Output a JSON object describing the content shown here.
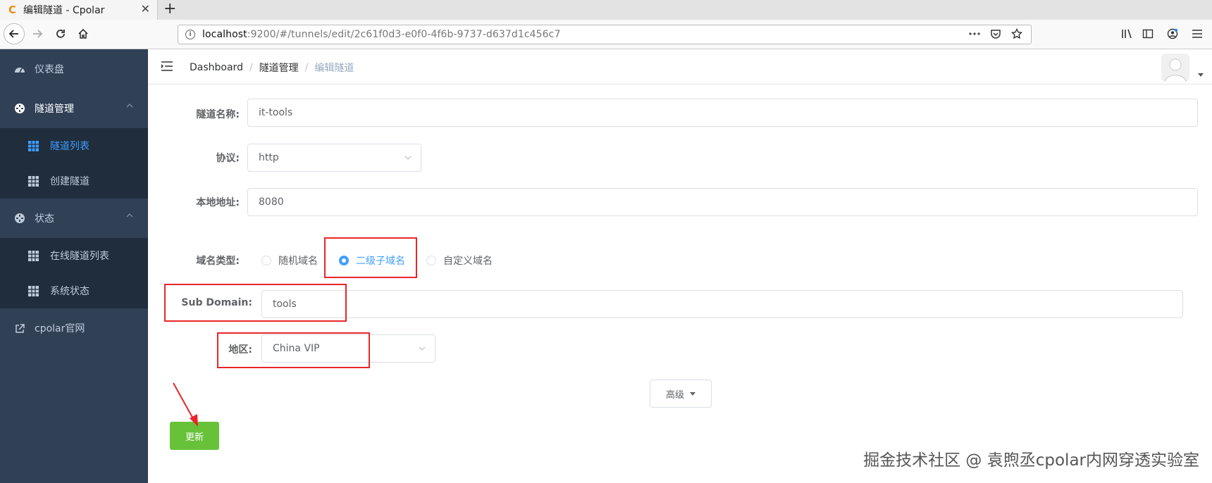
{
  "browser": {
    "tab_title": "编辑隧道 - Cpolar",
    "tab_favicon": "C",
    "url_host": "localhost",
    "url_rest": ":9200/#/tunnels/edit/2c61f0d3-e0f0-4f6b-9737-d637d1c456c7",
    "new_tab_label": "+",
    "close_label": "✕"
  },
  "sidebar": {
    "items": [
      {
        "label": "仪表盘",
        "icon": "dashboard-icon"
      },
      {
        "label": "隧道管理",
        "icon": "tunnel-manage-icon"
      },
      {
        "label": "状态",
        "icon": "status-icon"
      },
      {
        "label": "cpolar官网",
        "icon": "external-link-icon"
      }
    ],
    "tunnel_sub": [
      {
        "label": "隧道列表",
        "active": true
      },
      {
        "label": "创建隧道",
        "active": false
      }
    ],
    "status_sub": [
      {
        "label": "在线隧道列表"
      },
      {
        "label": "系统状态"
      }
    ]
  },
  "breadcrumb": {
    "items": [
      "Dashboard",
      "隧道管理",
      "编辑隧道"
    ],
    "separator": "/"
  },
  "form": {
    "name_label": "隧道名称:",
    "name_value": "it-tools",
    "protocol_label": "协议:",
    "protocol_value": "http",
    "local_label": "本地地址:",
    "local_value": "8080",
    "domain_type_label": "域名类型:",
    "domain_options": [
      "随机域名",
      "二级子域名",
      "自定义域名"
    ],
    "domain_selected": "二级子域名",
    "subdomain_label": "Sub Domain:",
    "subdomain_value": "tools",
    "region_label": "地区:",
    "region_value": "China VIP",
    "advanced_label": "高级",
    "update_label": "更新"
  },
  "watermark": "掘金技术社区 @ 袁煦丞cpolar内网穿透实验室",
  "colors": {
    "sidebar_bg": "#304156",
    "submenu_bg": "#1f2d3d",
    "active": "#409eff",
    "update_button": "#67c23a",
    "highlight": "#e8262a"
  }
}
